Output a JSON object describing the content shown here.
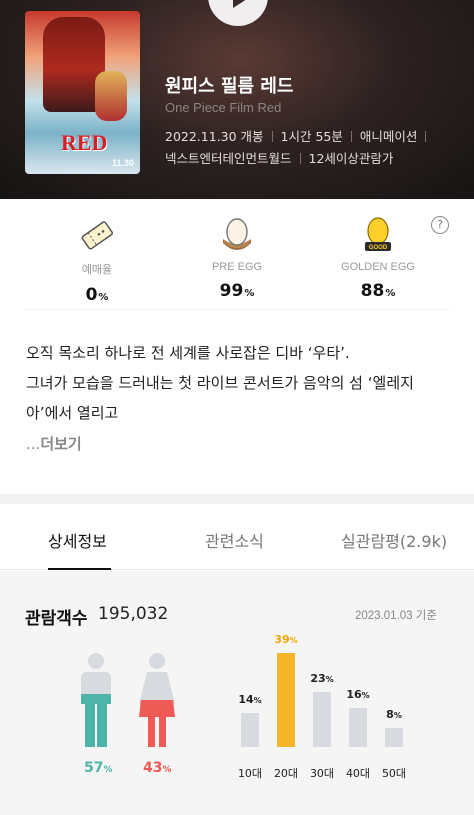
{
  "movie": {
    "title": "원피스 필름 레드",
    "subtitle": "One Piece Film Red",
    "release": "2022.11.30 개봉",
    "runtime": "1시간 55분",
    "genre": "애니메이션",
    "distributor": "넥스트엔터테인먼트월드",
    "rating": "12세이상관람가",
    "poster_text": "RED",
    "poster_date": "11.30"
  },
  "stats": [
    {
      "label": "예매율",
      "value": "0",
      "unit": "%",
      "icon": "ticket-icon"
    },
    {
      "label": "PRE EGG",
      "value": "99",
      "unit": "%",
      "icon": "egg-icon"
    },
    {
      "label": "GOLDEN EGG",
      "value": "88",
      "unit": "%",
      "icon": "golden-egg-icon",
      "badge": "GOOD"
    }
  ],
  "synopsis": {
    "line1": "오직 목소리 하나로 전 세계를 사로잡은 디바 ‘우타’.",
    "line2": "그녀가 모습을 드러내는 첫 라이브 콘서트가 음악의 섬 ‘엘레지",
    "line3": "아’에서 열리고",
    "more_prefix": "...",
    "more": "더보기"
  },
  "tabs": [
    "상세정보",
    "관련소식",
    "실관람평(2.9k)"
  ],
  "audience": {
    "title": "관람객수",
    "count": "195,032",
    "basis": "2023.01.03 기준",
    "gender": [
      {
        "label": "male",
        "value": "57",
        "unit": "%",
        "color": "#4eb3a8"
      },
      {
        "label": "female",
        "value": "43",
        "unit": "%",
        "color": "#ee5a55"
      }
    ],
    "colors": {
      "accent": "#f7b52a",
      "bar": "#d7dbdf"
    }
  },
  "chart_data": {
    "type": "bar",
    "categories": [
      "10대",
      "20대",
      "30대",
      "40대",
      "50대"
    ],
    "values": [
      14,
      39,
      23,
      16,
      8
    ],
    "unit": "%",
    "highlight": "20대"
  }
}
